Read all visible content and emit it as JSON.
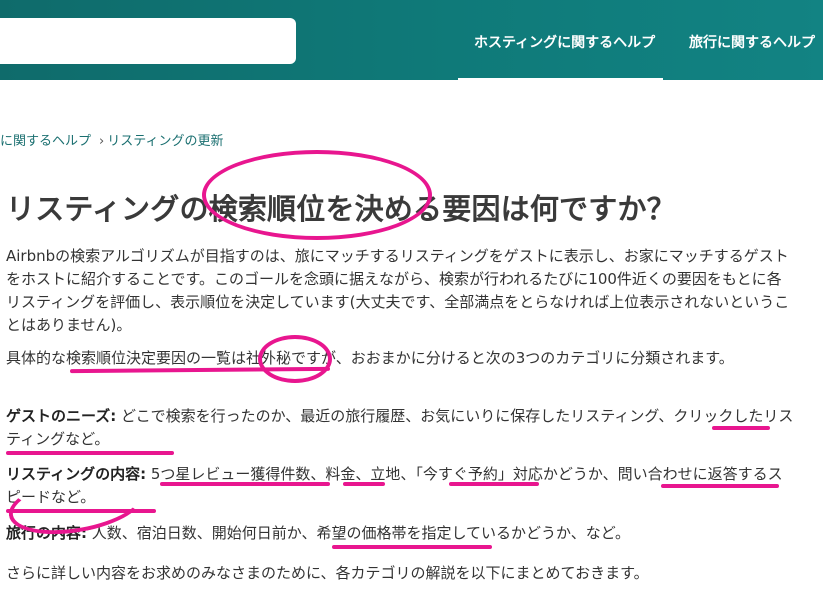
{
  "header": {
    "tabs": [
      {
        "label": "ホスティングに関するヘルプ"
      },
      {
        "label": "旅行に関するヘルプ"
      }
    ]
  },
  "breadcrumb": [
    "に関するヘルプ",
    "リスティングの更新"
  ],
  "article": {
    "title": "リスティングの検索順位を決める要因は何ですか？",
    "intro": "Airbnbの検索アルゴリズムが目指すのは、旅にマッチするリスティングをゲストに表示し、お家にマッチするゲストをホストに紹介することです。このゴールを念頭に据えながら、検索が行われるたびに100件近くの要因をもとに各リスティングを評価し、表示順位を決定しています(大丈夫です、全部満点をとらなければ上位表示されないということはありません)。",
    "categories_intro": "具体的な検索順位決定要因の一覧は社外秘ですが、おおまかに分けると次の3つのカテゴリに分類されます。",
    "guest_needs_label": "ゲストのニーズ:",
    "guest_needs_text": " どこで検索を行ったのか、最近の旅行履歴、お気にいりに保存したリスティング、クリックしたリスティングなど。",
    "listing_content_label": "リスティングの内容:",
    "listing_content_text": " 5つ星レビュー獲得件数、料金、立地、「今すぐ予約」対応かどうか、問い合わせに返答するスピードなど。",
    "trip_content_label": "旅行の内容:",
    "trip_content_text": " 人数、宿泊日数、開始何日前か、希望の価格帯を指定しているかどうか、など。",
    "closing": "さらに詳しい内容をお求めのみなさまのために、各カテゴリの解説を以下にまとめておきます。"
  },
  "colors": {
    "header_bg": "#0f7a79",
    "link": "#1a6f70",
    "annotation": "#e8168f"
  }
}
